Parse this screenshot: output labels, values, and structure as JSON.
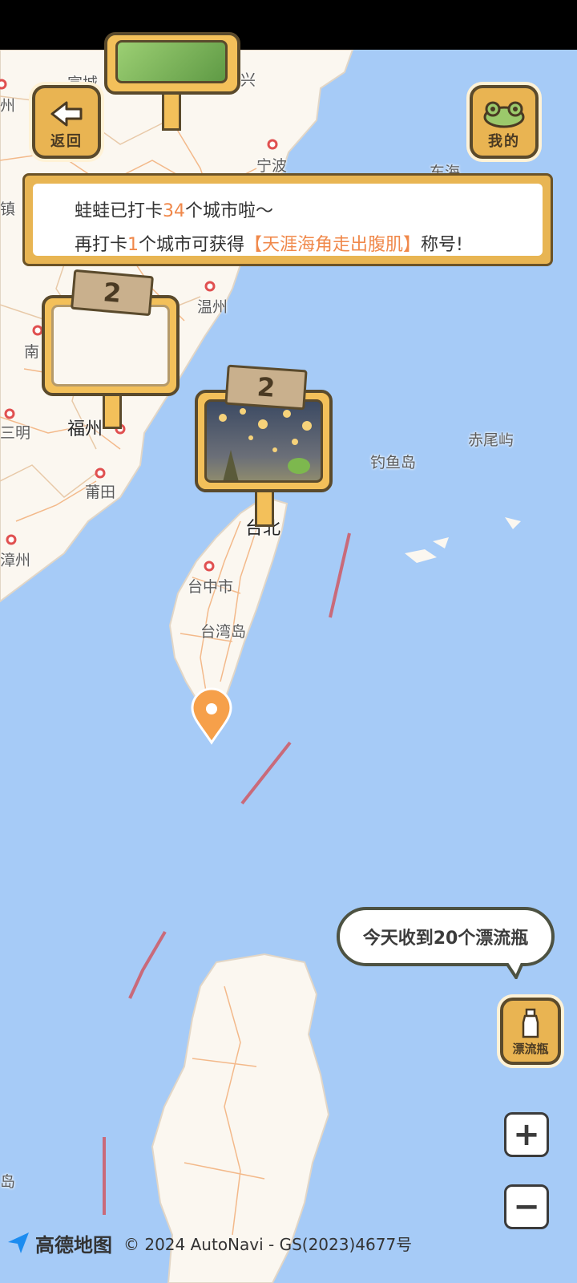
{
  "map": {
    "cities": [
      {
        "id": "ningbo",
        "name": "宁波"
      },
      {
        "id": "wenzhou",
        "name": "温州"
      },
      {
        "id": "fuzhou",
        "name": "福州"
      },
      {
        "id": "putian",
        "name": "莆田"
      },
      {
        "id": "sanming",
        "name": "三明"
      },
      {
        "id": "zhangzhou",
        "name": "漳州"
      },
      {
        "id": "nan",
        "name": "南"
      },
      {
        "id": "taizhong",
        "name": "台中市"
      },
      {
        "id": "taiwandao",
        "name": "台湾岛"
      },
      {
        "id": "taibei",
        "name": "台北"
      },
      {
        "id": "diaoyudao",
        "name": "钓鱼岛"
      },
      {
        "id": "chiweiyu",
        "name": "赤尾屿"
      },
      {
        "id": "xuancheng",
        "name": "宣城"
      },
      {
        "id": "zhou",
        "name": "州"
      },
      {
        "id": "dao",
        "name": "岛"
      },
      {
        "id": "donghai",
        "name": "东海"
      },
      {
        "id": "xing",
        "name": "兴"
      },
      {
        "id": "zhen",
        "name": "镇"
      }
    ]
  },
  "buttons": {
    "back_label": "返回",
    "mine_label": "我的",
    "bottle_label": "漂流瓶"
  },
  "banner": {
    "line1_prefix": "蛙蛙已打卡",
    "line1_count": "34",
    "line1_suffix": "个城市啦～",
    "line2_prefix": "再打卡",
    "line2_count": "1",
    "line2_middle": "个城市可获得",
    "line2_title": "【天涯海角走出腹肌】",
    "line2_suffix": "称号!"
  },
  "signs": [
    {
      "id": "top",
      "count": ""
    },
    {
      "id": "fuzhou",
      "count": "2"
    },
    {
      "id": "taipei",
      "count": "2"
    }
  ],
  "bubble": {
    "text": "今天收到20个漂流瓶"
  },
  "zoom": {
    "in_label": "+",
    "out_label": "−"
  },
  "footer": {
    "brand": "高德地图",
    "copyright": "© 2024 AutoNavi - GS(2023)4677号"
  },
  "colors": {
    "sea": "#a6cbf7",
    "land": "#fbf7f0",
    "wood": "#e9b452",
    "accent": "#f0884a"
  }
}
